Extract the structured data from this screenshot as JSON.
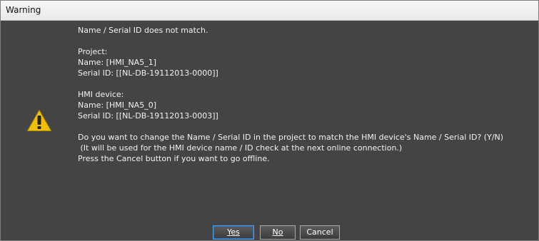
{
  "window": {
    "title": "Warning"
  },
  "icon": {
    "name": "warning-icon",
    "color": "#f0c000"
  },
  "message": {
    "headline": "Name / Serial ID does not match.",
    "project_label": "Project:",
    "project_name": "Name: [HMI_NA5_1]",
    "project_serial": "Serial ID: [[NL-DB-19112013-0000]]",
    "device_label": "HMI device:",
    "device_name": "Name: [HMI_NA5_0]",
    "device_serial": "Serial ID: [[NL-DB-19112013-0003]]",
    "question": "Do you want to change the Name / Serial ID in the project to match the HMI device's Name / Serial ID? (Y/N)",
    "note": " (It will be used for the HMI device name / ID check at the next online connection.)",
    "cancel_hint": "Press the Cancel button if you want to go offline."
  },
  "buttons": {
    "yes_label": "Yes",
    "no_label": "No",
    "cancel_label": "Cancel"
  }
}
